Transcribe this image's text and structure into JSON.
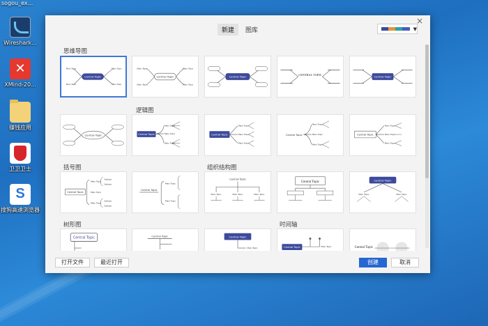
{
  "desktop": {
    "top_label": "sogou_ex...",
    "icons": [
      {
        "label": "Wireshark...",
        "icon": "wireshark-icon"
      },
      {
        "label": "XMind-20...",
        "icon": "xmind-icon"
      },
      {
        "label": "赚钱应用",
        "icon": "folder-icon"
      },
      {
        "label": "卫卫卫士",
        "icon": "security-shield-icon"
      },
      {
        "label": "搜狗高速浏览器",
        "icon": "sogou-browser-icon"
      }
    ]
  },
  "dialog": {
    "tabs": [
      {
        "label": "新建"
      },
      {
        "label": "图库"
      }
    ],
    "theme_colors": [
      "#3d4a9c",
      "#e8933a",
      "#2aa3a0",
      "#4a5cc0"
    ],
    "categories": {
      "mindmap": "思维导图",
      "logic": "逻辑图",
      "bracket": "括号图",
      "org": "组织结构图",
      "tree": "树形图",
      "timeline": "时间轴"
    },
    "node_labels": {
      "central": "Central Topic",
      "main": "Main Topic",
      "sub": "Subtopic",
      "central_caps": "CENTRAL TOPIC"
    },
    "buttons": {
      "open_file": "打开文件",
      "recent": "最近打开",
      "create": "创建",
      "cancel": "取消"
    },
    "close_glyph": "×"
  }
}
